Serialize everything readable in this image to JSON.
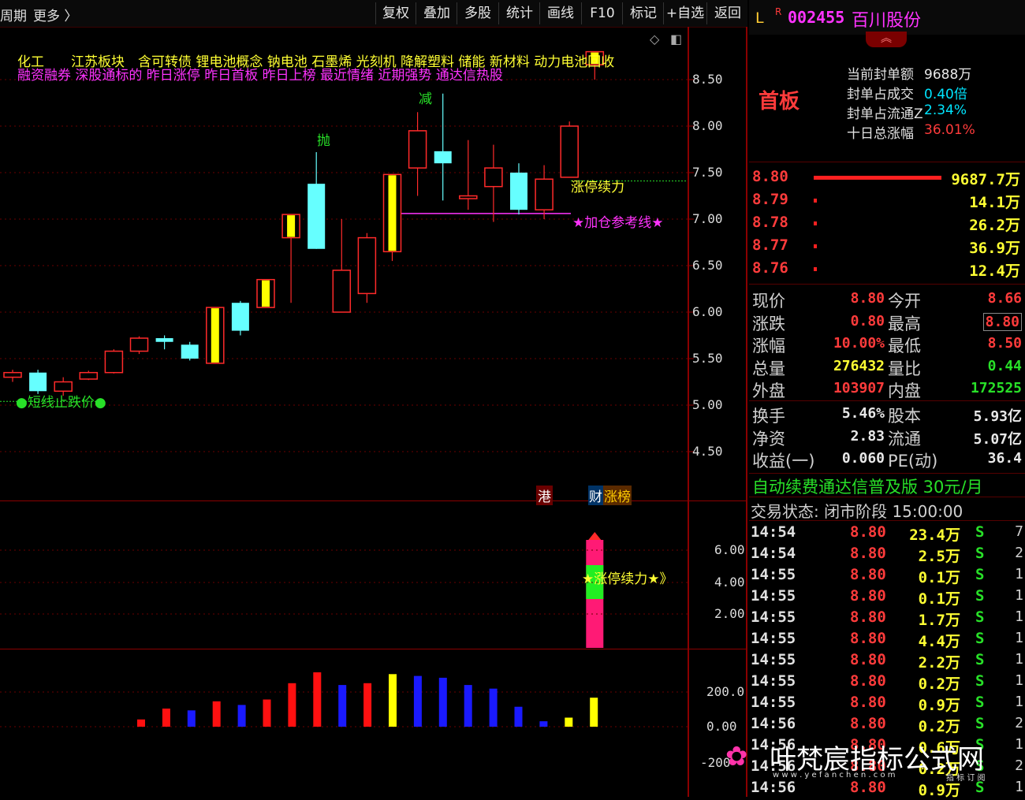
{
  "toolbar": {
    "left_items": [
      "周期",
      "更多 〉"
    ],
    "buttons": [
      "复权",
      "叠加",
      "多股",
      "统计",
      "画线",
      "F10",
      "标记",
      "+自选",
      "返回"
    ]
  },
  "chart": {
    "sector_line": "化工　　江苏板块　含可转债 锂电池概念 钠电池 石墨烯 光刻机 降解塑料 储能 新材料 动力电池回收",
    "tag_line": "融资融券 深股通标的 昨日涨停 昨日首板 昨日上榜 最近情绪 近期强势 通达信热股",
    "y_ticks": [
      "8.50",
      "8.00",
      "7.50",
      "7.00",
      "6.50",
      "6.00",
      "5.50",
      "5.00",
      "4.50"
    ],
    "annotations": {
      "throw": "抛",
      "reduce": "减",
      "limit_up_continue": "涨停续力",
      "add_ref_line": "★加仓参考线★",
      "stop_loss": "●短线止跌价●"
    },
    "badges": {
      "hk": "港",
      "fin": "财",
      "zhangbang": "涨榜"
    },
    "candles": [
      {
        "o": 5.3,
        "c": 5.35,
        "h": 5.38,
        "l": 5.25,
        "color": "red"
      },
      {
        "o": 5.35,
        "c": 5.15,
        "h": 5.38,
        "l": 5.12,
        "color": "cyan"
      },
      {
        "o": 5.15,
        "c": 5.25,
        "h": 5.3,
        "l": 5.1,
        "color": "red"
      },
      {
        "o": 5.28,
        "c": 5.35,
        "h": 5.37,
        "l": 5.27,
        "color": "red"
      },
      {
        "o": 5.35,
        "c": 5.58,
        "h": 5.6,
        "l": 5.34,
        "color": "red"
      },
      {
        "o": 5.58,
        "c": 5.72,
        "h": 5.74,
        "l": 5.55,
        "color": "red"
      },
      {
        "o": 5.72,
        "c": 5.68,
        "h": 5.75,
        "l": 5.6,
        "color": "cyan"
      },
      {
        "o": 5.65,
        "c": 5.5,
        "h": 5.68,
        "l": 5.48,
        "color": "cyan"
      },
      {
        "o": 5.45,
        "c": 6.05,
        "h": 6.05,
        "l": 5.45,
        "color": "yellow"
      },
      {
        "o": 6.1,
        "c": 5.8,
        "h": 6.12,
        "l": 5.75,
        "color": "cyan"
      },
      {
        "o": 6.05,
        "c": 6.35,
        "h": 6.35,
        "l": 6.05,
        "color": "yellow"
      },
      {
        "o": 6.8,
        "c": 7.05,
        "h": 7.05,
        "l": 6.1,
        "color": "yellow"
      },
      {
        "o": 7.38,
        "c": 6.68,
        "h": 7.72,
        "l": 6.68,
        "color": "cyan"
      },
      {
        "o": 6.0,
        "c": 6.45,
        "h": 7.0,
        "l": 6.0,
        "color": "red"
      },
      {
        "o": 6.2,
        "c": 6.8,
        "h": 6.85,
        "l": 6.1,
        "color": "red"
      },
      {
        "o": 6.65,
        "c": 7.48,
        "h": 7.48,
        "l": 6.55,
        "color": "yellow"
      },
      {
        "o": 7.55,
        "c": 7.95,
        "h": 8.15,
        "l": 7.25,
        "color": "red"
      },
      {
        "o": 7.73,
        "c": 7.6,
        "h": 8.35,
        "l": 7.2,
        "color": "cyan"
      },
      {
        "o": 7.22,
        "c": 7.25,
        "h": 7.85,
        "l": 7.1,
        "color": "red"
      },
      {
        "o": 7.35,
        "c": 7.55,
        "h": 7.8,
        "l": 6.97,
        "color": "red"
      },
      {
        "o": 7.5,
        "c": 7.1,
        "h": 7.6,
        "l": 7.05,
        "color": "cyan"
      },
      {
        "o": 7.1,
        "c": 7.43,
        "h": 7.58,
        "l": 7.0,
        "color": "red"
      },
      {
        "o": 7.45,
        "c": 8.0,
        "h": 8.05,
        "l": 7.45,
        "color": "red"
      },
      {
        "o": 8.8,
        "c": 8.66,
        "h": 8.8,
        "l": 8.5,
        "color": "yellow"
      }
    ],
    "sub1_ticks": [
      "6.00",
      "4.00",
      "2.00"
    ],
    "sub1_label": "★涨停续力★》",
    "sub2_ticks": [
      "200.0",
      "0.00",
      "-200"
    ],
    "sub2_bars": [
      {
        "v": 20,
        "color": "red"
      },
      {
        "v": 50,
        "color": "red"
      },
      {
        "v": 45,
        "color": "blue"
      },
      {
        "v": 70,
        "color": "red"
      },
      {
        "v": 60,
        "color": "blue"
      },
      {
        "v": 75,
        "color": "red"
      },
      {
        "v": 120,
        "color": "red"
      },
      {
        "v": 150,
        "color": "red"
      },
      {
        "v": 115,
        "color": "blue"
      },
      {
        "v": 120,
        "color": "red"
      },
      {
        "v": 145,
        "color": "yellow"
      },
      {
        "v": 140,
        "color": "blue"
      },
      {
        "v": 135,
        "color": "blue"
      },
      {
        "v": 115,
        "color": "blue"
      },
      {
        "v": 105,
        "color": "blue"
      },
      {
        "v": 55,
        "color": "blue"
      },
      {
        "v": 15,
        "color": "blue"
      },
      {
        "v": 25,
        "color": "yellow"
      },
      {
        "v": 80,
        "color": "yellow"
      }
    ]
  },
  "quote": {
    "prefix": "L",
    "flag": "R",
    "code": "002455",
    "name": "百川股份",
    "board": "首板",
    "seal_items": [
      {
        "label": "当前封单额",
        "value": "9688万",
        "color": "#e8e8e8"
      },
      {
        "label": "封单占成交",
        "value": "0.40倍",
        "color": "#00e5ff"
      },
      {
        "label": "封单占流通Z",
        "value": "2.34%",
        "color": "#00e5ff"
      },
      {
        "label": "十日总涨幅",
        "value": "36.01%",
        "color": "#ff3b3b"
      }
    ],
    "book": [
      {
        "price": "8.80",
        "vol": "9687.7万"
      },
      {
        "price": "8.79",
        "vol": "14.1万"
      },
      {
        "price": "8.78",
        "vol": "26.2万"
      },
      {
        "price": "8.77",
        "vol": "36.9万"
      },
      {
        "price": "8.76",
        "vol": "12.4万"
      }
    ],
    "stats": [
      {
        "l1": "现价",
        "v1": "8.80",
        "c1": "#ff3b3b",
        "l2": "今开",
        "v2": "8.66",
        "c2": "#ff3b3b"
      },
      {
        "l1": "涨跌",
        "v1": "0.80",
        "c1": "#ff3b3b",
        "l2": "最高",
        "v2": "8.80",
        "c2": "#ff3b3b"
      },
      {
        "l1": "涨幅",
        "v1": "10.00%",
        "c1": "#ff3b3b",
        "l2": "最低",
        "v2": "8.50",
        "c2": "#ff3b3b"
      },
      {
        "l1": "总量",
        "v1": "276432",
        "c1": "#ffff33",
        "l2": "量比",
        "v2": "0.44",
        "c2": "#28e028"
      },
      {
        "l1": "外盘",
        "v1": "103907",
        "c1": "#ff3b3b",
        "l2": "内盘",
        "v2": "172525",
        "c2": "#28e028"
      }
    ],
    "stats2": [
      {
        "l1": "换手",
        "v1": "5.46%",
        "l2": "股本",
        "v2": "5.93亿"
      },
      {
        "l1": "净资",
        "v1": "2.83",
        "l2": "流通",
        "v2": "5.07亿"
      },
      {
        "l1": "收益(一)",
        "v1": "0.060",
        "l2": "PE(动)",
        "v2": "36.4"
      }
    ],
    "promo": "自动续费通达信普及版  30元/月",
    "trade_state": "交易状态: 闭市阶段 15:00:00",
    "ticks": [
      {
        "t": "14:54",
        "p": "8.80",
        "v": "23.4万",
        "s": "S",
        "n": "7"
      },
      {
        "t": "14:54",
        "p": "8.80",
        "v": "2.5万",
        "s": "S",
        "n": "2"
      },
      {
        "t": "14:55",
        "p": "8.80",
        "v": "0.1万",
        "s": "S",
        "n": "1"
      },
      {
        "t": "14:55",
        "p": "8.80",
        "v": "0.1万",
        "s": "S",
        "n": "1"
      },
      {
        "t": "14:55",
        "p": "8.80",
        "v": "1.7万",
        "s": "S",
        "n": "1"
      },
      {
        "t": "14:55",
        "p": "8.80",
        "v": "4.4万",
        "s": "S",
        "n": "1"
      },
      {
        "t": "14:55",
        "p": "8.80",
        "v": "2.2万",
        "s": "S",
        "n": "1"
      },
      {
        "t": "14:55",
        "p": "8.80",
        "v": "0.2万",
        "s": "S",
        "n": "1"
      },
      {
        "t": "14:55",
        "p": "8.80",
        "v": "0.9万",
        "s": "S",
        "n": "1"
      },
      {
        "t": "14:56",
        "p": "8.80",
        "v": "0.2万",
        "s": "S",
        "n": "2"
      },
      {
        "t": "14:56",
        "p": "8.80",
        "v": "0.6万",
        "s": "S",
        "n": "1"
      },
      {
        "t": "14:56",
        "p": "8.80",
        "v": "0.2万",
        "s": "S",
        "n": "2"
      },
      {
        "t": "14:56",
        "p": "8.80",
        "v": "0.9万",
        "s": "S",
        "n": "1"
      }
    ]
  },
  "watermark": {
    "title": "叶梵宸指标公式网",
    "sub": "w w w . y e f a n c h e n . c o m",
    "sub2": "指 标 订 阅"
  }
}
